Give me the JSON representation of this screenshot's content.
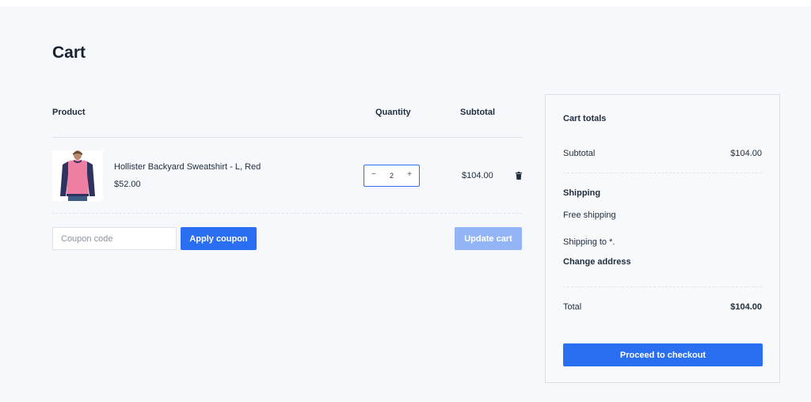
{
  "page": {
    "title": "Cart"
  },
  "table": {
    "headers": {
      "product": "Product",
      "quantity": "Quantity",
      "subtotal": "Subtotal"
    },
    "rows": [
      {
        "name": "Hollister Backyard Sweatshirt - L, Red",
        "price": "$52.00",
        "quantity": "2",
        "subtotal": "$104.00"
      }
    ]
  },
  "actions": {
    "coupon_placeholder": "Coupon code",
    "apply_coupon": "Apply coupon",
    "update_cart": "Update cart"
  },
  "totals": {
    "heading": "Cart totals",
    "subtotal_label": "Subtotal",
    "subtotal_value": "$104.00",
    "shipping_heading": "Shipping",
    "shipping_method": "Free shipping",
    "shipping_to": "Shipping to *.",
    "change_address": "Change address",
    "total_label": "Total",
    "total_value": "$104.00",
    "checkout": "Proceed to checkout"
  },
  "icons": {
    "remove": "trash-icon",
    "product_image": "sweatshirt-image"
  },
  "colors": {
    "accent": "#2a6ff2",
    "accent_disabled": "#93b5f6",
    "background": "#f6f8fb",
    "text": "#1e2d3d"
  }
}
